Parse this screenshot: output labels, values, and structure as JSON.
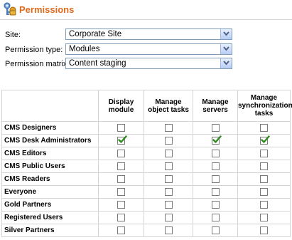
{
  "header": {
    "title": "Permissions"
  },
  "form": {
    "site_label": "Site:",
    "site_value": "Corporate Site",
    "type_label": "Permission type:",
    "type_value": "Modules",
    "matrix_label": "Permission matrix:",
    "matrix_value": "Content staging"
  },
  "table": {
    "columns": [
      "Display module",
      "Manage object tasks",
      "Manage servers",
      "Manage synchronization tasks"
    ],
    "rows": [
      {
        "role": "CMS Designers",
        "checks": [
          false,
          false,
          false,
          false
        ]
      },
      {
        "role": "CMS Desk Administrators",
        "checks": [
          true,
          false,
          true,
          true
        ]
      },
      {
        "role": "CMS Editors",
        "checks": [
          false,
          false,
          false,
          false
        ]
      },
      {
        "role": "CMS Public Users",
        "checks": [
          false,
          false,
          false,
          false
        ]
      },
      {
        "role": "CMS Readers",
        "checks": [
          false,
          false,
          false,
          false
        ]
      },
      {
        "role": "Everyone",
        "checks": [
          false,
          false,
          false,
          false
        ]
      },
      {
        "role": "Gold Partners",
        "checks": [
          false,
          false,
          false,
          false
        ]
      },
      {
        "role": "Registered Users",
        "checks": [
          false,
          false,
          false,
          false
        ]
      },
      {
        "role": "Silver Partners",
        "checks": [
          false,
          false,
          false,
          false
        ]
      }
    ]
  },
  "colors": {
    "title": "#e06a1b",
    "check": "#2e8b1e",
    "border": "#d4d4d4"
  },
  "icons": {
    "logo": "permissions-key-icon",
    "dropdown": "chevron-down-icon",
    "checkmark": "checkmark-icon"
  }
}
